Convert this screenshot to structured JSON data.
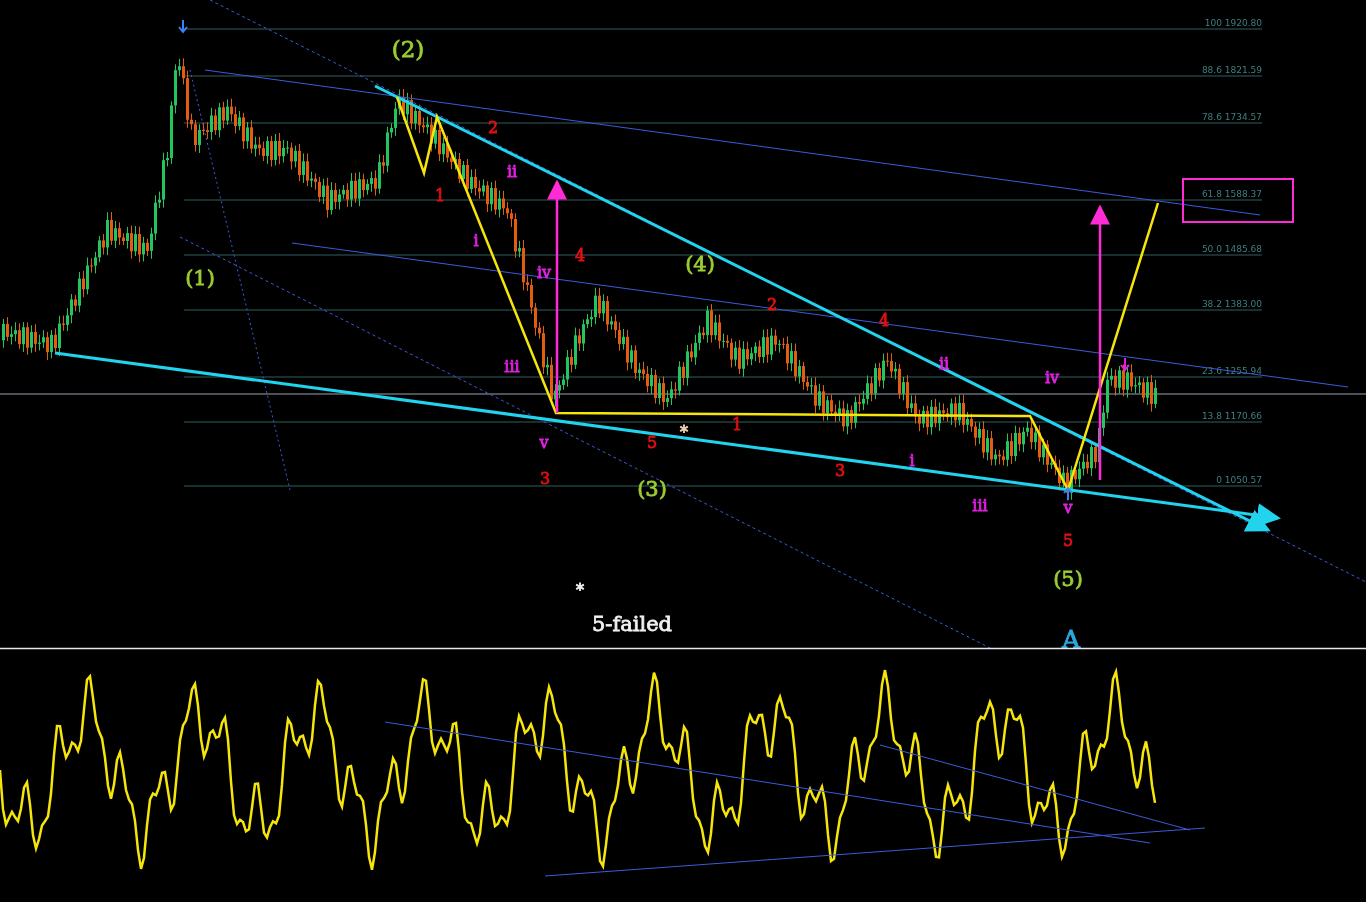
{
  "chart": {
    "fib_levels": [
      {
        "label": "100 1920.80"
      },
      {
        "label": "88.6 1821.59"
      },
      {
        "label": "78.6 1734.57"
      },
      {
        "label": "61.8 1588.37"
      },
      {
        "label": "50.0 1485.68"
      },
      {
        "label": "38.2 1383.00"
      },
      {
        "label": "23.6 1255.94"
      },
      {
        "label": "13.8 1170.66"
      },
      {
        "label": "0 1050.57"
      }
    ],
    "wave_labels": [
      {
        "text": "(2)",
        "color": "#9acd32"
      },
      {
        "text": "(1)",
        "color": "#9acd32"
      },
      {
        "text": "2",
        "color": "#e01010"
      },
      {
        "text": "1",
        "color": "#e01010"
      },
      {
        "text": "ii",
        "color": "#e020e0"
      },
      {
        "text": "i",
        "color": "#e020e0"
      },
      {
        "text": "iv",
        "color": "#e020e0"
      },
      {
        "text": "4",
        "color": "#e01010"
      },
      {
        "text": "iii",
        "color": "#e020e0"
      },
      {
        "text": "v",
        "color": "#e020e0"
      },
      {
        "text": "3",
        "color": "#e01010"
      },
      {
        "text": "5",
        "color": "#e01010"
      },
      {
        "text": "*",
        "color": "#f0d0b0"
      },
      {
        "text": "1",
        "color": "#e01010"
      },
      {
        "text": "(3)",
        "color": "#9acd32"
      },
      {
        "text": "(4)",
        "color": "#9acd32"
      },
      {
        "text": "2",
        "color": "#e01010"
      },
      {
        "text": "4",
        "color": "#e01010"
      },
      {
        "text": "ii",
        "color": "#e020e0"
      },
      {
        "text": "3",
        "color": "#e01010"
      },
      {
        "text": "i",
        "color": "#e020e0"
      },
      {
        "text": "iii",
        "color": "#e020e0"
      },
      {
        "text": "iv",
        "color": "#e020e0"
      },
      {
        "text": "v",
        "color": "#e020e0"
      },
      {
        "text": "5",
        "color": "#e01010"
      },
      {
        "text": "(5)",
        "color": "#9acd32"
      },
      {
        "text": "*",
        "color": "#f0f0f0"
      },
      {
        "text": "5-failed",
        "color": "#f0f0f0"
      },
      {
        "text": "A",
        "color": "#2aa8e0"
      }
    ]
  }
}
